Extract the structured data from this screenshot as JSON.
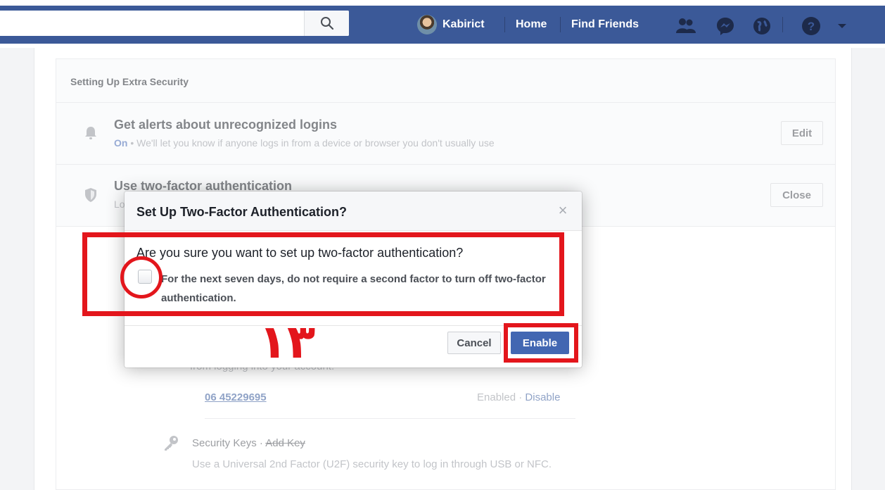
{
  "header": {
    "profile_name": "Kabirict",
    "home_label": "Home",
    "find_friends_label": "Find Friends",
    "brand_color": "#3b5998"
  },
  "panel": {
    "title": "Setting Up Extra Security",
    "alerts": {
      "title": "Get alerts about unrecognized logins",
      "status": "On",
      "description": " • We'll let you know if anyone logs in from a device or browser you don't usually use",
      "button": "Edit",
      "icon": "bell-icon"
    },
    "two_factor": {
      "title": "Use two-factor authentication",
      "subtitle_fragment": "Lo",
      "button": "Close",
      "icon": "shield-icon"
    },
    "hidden_line": "from logging into your account.",
    "phone": {
      "number": "06 45229695",
      "status": "Enabled",
      "separator": " · ",
      "disable_label": "Disable"
    },
    "security_keys": {
      "title": "Security Keys",
      "separator": " · ",
      "add_key_label": "Add Key",
      "description": "Use a Universal 2nd Factor (U2F) security key to log in through USB or NFC.",
      "icon": "key-icon"
    }
  },
  "dialog": {
    "title": "Set Up Two-Factor Authentication?",
    "question": "Are you sure you want to set up two-factor authentication?",
    "option": "For the next seven days, do not require a second factor to turn off two-factor authentication.",
    "option_checked": false,
    "cancel_label": "Cancel",
    "enable_label": "Enable",
    "close_symbol": "×"
  },
  "annotation": {
    "step_number": "۱۳",
    "color": "#e3161c"
  }
}
